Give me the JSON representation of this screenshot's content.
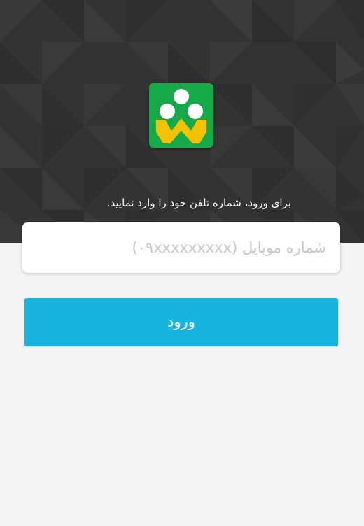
{
  "header": {
    "background_color": "#333333",
    "logo_icon": "app-logo-icon",
    "logo_background": "#16a94a",
    "logo_accent": "#f4c200",
    "prompt_text": "برای ورود، شماره تلفن خود را وارد نمایید."
  },
  "phone_field": {
    "value": "",
    "placeholder": "شماره موبایل (۰۹xxxxxxxxx)"
  },
  "login_button": {
    "label": "ورود",
    "color": "#16b4df"
  }
}
